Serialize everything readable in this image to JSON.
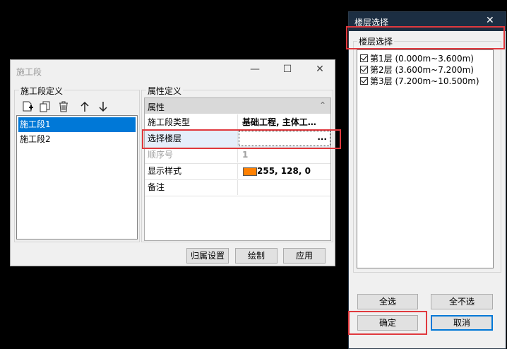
{
  "segment_dialog": {
    "title": "施工段",
    "minimize": "—",
    "maximize": "☐",
    "close": "✕",
    "segment_group_label": "施工段定义",
    "segments": [
      "施工段1",
      "施工段2"
    ],
    "property_group_label": "属性定义",
    "property_header": "属性",
    "collapse_glyph": "⌃",
    "properties": [
      {
        "name": "施工段类型",
        "value": "基础工程, 主体工…"
      },
      {
        "name": "选择楼层",
        "value": ""
      },
      {
        "name": "顺序号",
        "value": "1"
      },
      {
        "name": "显示样式",
        "value": "255, 128, 0"
      },
      {
        "name": "备注",
        "value": ""
      }
    ],
    "ellipsis": "...",
    "style_swatch_color": "#ff8000",
    "buttons": {
      "assign": "归属设置",
      "draw": "绘制",
      "apply": "应用"
    },
    "icons": [
      "add-icon",
      "copy-icon",
      "delete-icon",
      "arrow-up-icon",
      "arrow-down-icon"
    ]
  },
  "floor_dialog": {
    "title": "楼层选择",
    "close": "✕",
    "group_label": "楼层选择",
    "floors": [
      {
        "label": "第1层 (0.000m~3.600m)",
        "checked": true
      },
      {
        "label": "第2层 (3.600m~7.200m)",
        "checked": true
      },
      {
        "label": "第3层 (7.200m~10.500m)",
        "checked": true
      }
    ],
    "buttons": {
      "select_all": "全选",
      "select_none": "全不选",
      "ok": "确定",
      "cancel": "取消"
    }
  },
  "highlight_color": "#e0393e",
  "selection_color": "#0078d7"
}
